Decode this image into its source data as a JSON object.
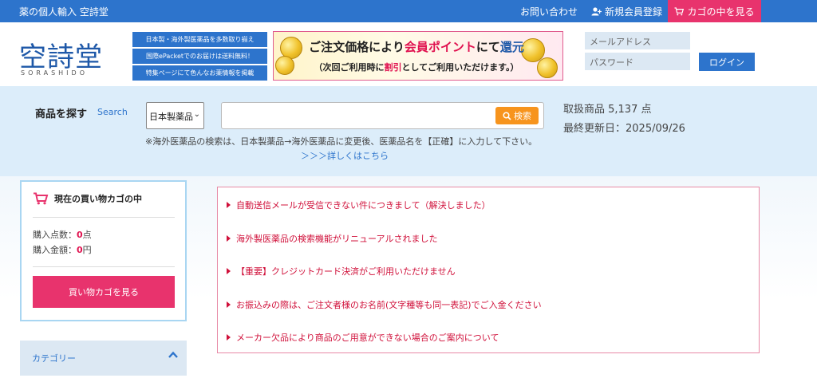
{
  "topbar": {
    "site_title": "薬の個人輸入 空詩堂",
    "contact_label": "お問い合わせ",
    "register_label": "新規会員登録",
    "cart_label": "カゴの中を見る"
  },
  "header": {
    "logo_text": "空詩堂",
    "logo_sub": "SORASHIDO",
    "promos": [
      "日本製・海外製医薬品を多数取り揃え",
      "国際ePacketでのお届けは送料無料！",
      "特集ページにて色んなお薬情報を掲載"
    ],
    "banner": {
      "line1_a": "ご注文価格により",
      "line1_b": "会員ポイント",
      "line1_c": "にて",
      "line1_d": "還元",
      "line2_a": "（次回ご利用時に",
      "line2_b": "割引",
      "line2_c": "としてご利用いただけます。）"
    },
    "login": {
      "email_placeholder": "メールアドレス",
      "password_placeholder": "パスワード",
      "button_label": "ログイン"
    }
  },
  "search": {
    "label": "商品を探す",
    "sub_label": "Search",
    "select_value": "日本製薬品",
    "button_label": "検索",
    "note": "※海外医薬品の検索は、日本製薬品→海外医薬品に変更後、医薬品名を【正確】に入力して下さい。",
    "more_link": "＞＞＞詳しくはこちら",
    "stats_count": "取扱商品 5,137 点",
    "stats_updated": "最終更新日：2025/09/26"
  },
  "cart": {
    "title": "現在の買い物カゴの中",
    "count_label": "購入点数：",
    "count_value": "0",
    "count_unit": "点",
    "amount_label": "購入金額：",
    "amount_value": "0",
    "amount_unit": "円",
    "view_button": "買い物カゴを見る"
  },
  "category": {
    "label": "カテゴリー"
  },
  "notices": [
    "自動送信メールが受信できない件につきまして（解決しました）",
    "海外製医薬品の検索機能がリニューアルされました",
    "【重要】クレジットカード決済がご利用いただけません",
    "お振込みの際は、ご注文者様のお名前(文字種等も同一表記)でご入金ください",
    "メーカー欠品により商品のご用意ができない場合のご案内について"
  ],
  "colors": {
    "primary_blue": "#2d74cc",
    "accent_pink": "#e8336d",
    "search_orange": "#f7941d",
    "notice_red": "#d0103a"
  }
}
